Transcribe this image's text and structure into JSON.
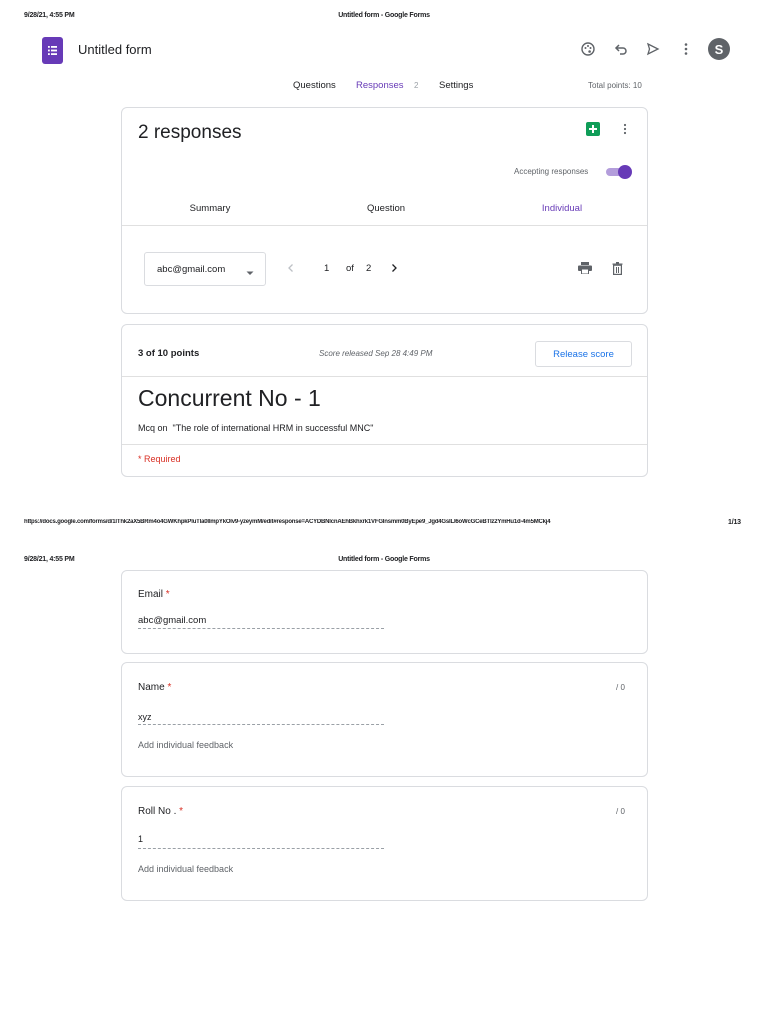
{
  "print_header": {
    "date": "9/28/21, 4:55 PM",
    "title": "Untitled form - Google Forms"
  },
  "app": {
    "form_title": "Untitled form",
    "avatar_letter": "S"
  },
  "tabs": {
    "questions": "Questions",
    "responses": "Responses",
    "responses_count": "2",
    "settings": "Settings",
    "total_points": "Total points: 10"
  },
  "responses_card": {
    "heading": "2 responses",
    "accepting_label": "Accepting responses",
    "subtabs": [
      "Summary",
      "Question",
      "Individual"
    ],
    "active_subtab": "Individual"
  },
  "navigator": {
    "selected_email": "abc@gmail.com",
    "current": "1",
    "of_label": "of",
    "total": "2"
  },
  "score": {
    "points": "3 of 10 points",
    "released": "Score released Sep 28 4:49 PM",
    "release_button": "Release score"
  },
  "form": {
    "title": "Concurrent No - 1",
    "description": "Mcq on  \"The role of international HRM in successful MNC\"",
    "required_note": "* Required"
  },
  "print_footer": {
    "url": "https://docs.google.com/forms/d/1lThk2aX5BRm4o4GWKhpkPluTla0IlmpYkOlv9-yzeymM/edit#response=ACYDBNlcnAEhBkhxrk1VFGInsmm0ByEpe9_Jgd4GsILI6oWcGCeBTlz2YmHu1d-4m5MCkj4",
    "page": "1/13"
  },
  "questions": [
    {
      "label": "Email",
      "required": "*",
      "answer": "abc@gmail.com",
      "points": "",
      "feedback": ""
    },
    {
      "label": "Name",
      "required": "*",
      "answer": "xyz",
      "points": "/ 0",
      "feedback": "Add individual feedback"
    },
    {
      "label": "Roll No .",
      "required": "*",
      "answer": "1",
      "points": "/ 0",
      "feedback": "Add individual feedback"
    }
  ],
  "colors": {
    "accent": "#673ab7",
    "sheets_green": "#0f9d58",
    "release_blue": "#1a73e8",
    "required_red": "#d93025"
  },
  "icons": [
    "forms-app-icon",
    "palette-icon",
    "undo-icon",
    "send-icon",
    "more-vert-icon",
    "sheets-icon",
    "dropdown-arrow-icon",
    "chevron-left-icon",
    "chevron-right-icon",
    "print-icon",
    "delete-icon"
  ]
}
